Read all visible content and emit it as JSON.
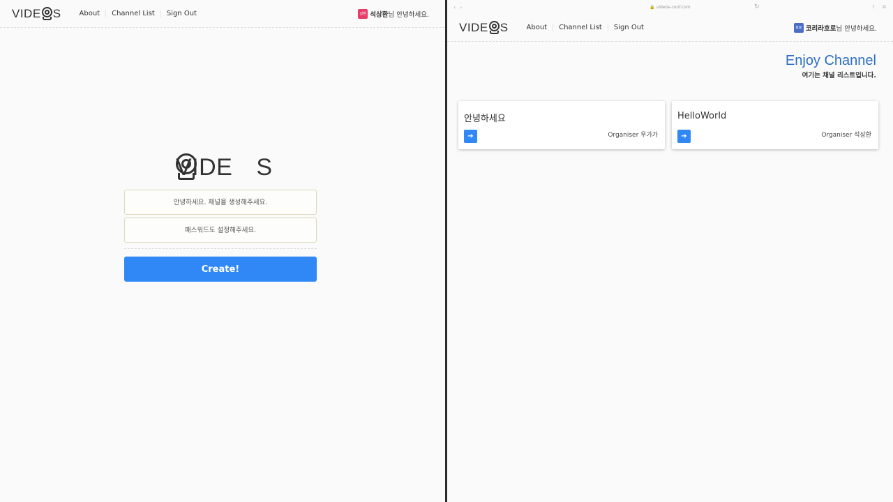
{
  "colors": {
    "accent": "#2f88f6",
    "title_blue": "#2f6fc2",
    "left_avatar": "#e63c6a",
    "right_avatar": "#4a6dc8"
  },
  "left": {
    "logo": {
      "prefix": "VIDE",
      "suffix": "S"
    },
    "nav": [
      "About",
      "Channel List",
      "Sign Out"
    ],
    "user": {
      "avatar_text": "상환",
      "name": "석상환",
      "suffix": "님 안녕하세요."
    },
    "form": {
      "channel_placeholder": "안녕하세요. 채널을 생성해주세요.",
      "password_placeholder": "패스워드도 설정해주세요.",
      "create_label": "Create!"
    }
  },
  "right": {
    "browser": {
      "url": "videos-conf.com",
      "back_icon": "chevron-left-icon",
      "forward_icon": "chevron-right-icon",
      "reload_icon": "reload-icon"
    },
    "logo": {
      "prefix": "VIDE",
      "suffix": "S"
    },
    "nav": [
      "About",
      "Channel List",
      "Sign Out"
    ],
    "user": {
      "avatar_text": "호로",
      "name": "코리라호로",
      "suffix": "님 안녕하세요."
    },
    "heading": {
      "title": "Enjoy Channel",
      "subtitle": "여기는 채널 리스트입니다."
    },
    "channels": [
      {
        "name": "안녕하세요",
        "organiser": "Organiser 우가가"
      },
      {
        "name": "HelloWorld",
        "organiser": "Organiser 석상환"
      }
    ]
  }
}
